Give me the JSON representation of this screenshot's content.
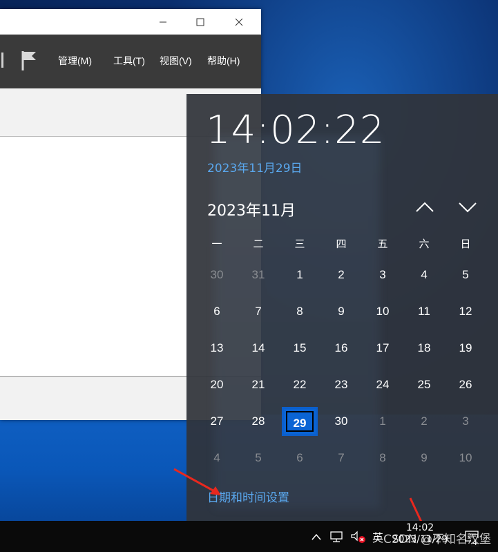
{
  "app": {
    "menu": [
      "管理(M)",
      "工具(T)",
      "视图(V)",
      "帮助(H)"
    ]
  },
  "flyout": {
    "time": "14:02:22",
    "date": "2023年11月29日",
    "month": "2023年11月",
    "weekdays": [
      "一",
      "二",
      "三",
      "四",
      "五",
      "六",
      "日"
    ],
    "weeks": [
      [
        "30",
        "31",
        "1",
        "2",
        "3",
        "4",
        "5"
      ],
      [
        "6",
        "7",
        "8",
        "9",
        "10",
        "11",
        "12"
      ],
      [
        "13",
        "14",
        "15",
        "16",
        "17",
        "18",
        "19"
      ],
      [
        "20",
        "21",
        "22",
        "23",
        "24",
        "25",
        "26"
      ],
      [
        "27",
        "28",
        "29",
        "30",
        "1",
        "2",
        "3"
      ],
      [
        "4",
        "5",
        "6",
        "7",
        "8",
        "9",
        "10"
      ]
    ],
    "today": "29",
    "settings_link": "日期和时间设置"
  },
  "taskbar": {
    "ime": "英",
    "clock_time": "14:02",
    "clock_date": "2023/11/29",
    "notification_count": "4",
    "watermark": "CSDN @不知名汉堡"
  },
  "colors": {
    "accent": "#0a64d4",
    "link": "#5aa8ee",
    "arrow": "#e8281e"
  }
}
